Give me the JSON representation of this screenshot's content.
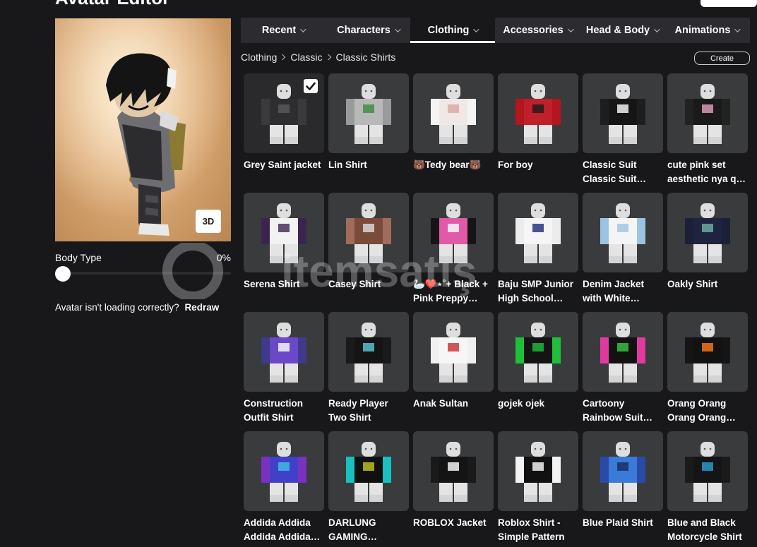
{
  "page": {
    "title": "Avatar Editor"
  },
  "preview": {
    "btn_3d": "3D",
    "body_type_label": "Body Type",
    "body_type_value": "0%",
    "body_type_fraction": 0,
    "loading_text": "Avatar isn't loading correctly?",
    "redraw_label": "Redraw"
  },
  "tabs": [
    {
      "label": "Recent",
      "active": false
    },
    {
      "label": "Characters",
      "active": false
    },
    {
      "label": "Clothing",
      "active": true
    },
    {
      "label": "Accessories",
      "active": false
    },
    {
      "label": "Head & Body",
      "active": false
    },
    {
      "label": "Animations",
      "active": false
    }
  ],
  "breadcrumb": [
    "Clothing",
    "Classic",
    "Classic Shirts"
  ],
  "create_label": "Create",
  "watermark": "itemsatış",
  "items": [
    {
      "name": [
        "Grey Saint jacket"
      ],
      "selected": true,
      "shirt": "#2e2e30",
      "sleeve": "#3a3a3c",
      "accent": "#5a5a5a"
    },
    {
      "name": [
        "Lin Shirt"
      ],
      "selected": false,
      "shirt": "#b8b8b8",
      "sleeve": "#9a9a9a",
      "accent": "#3a8a3a"
    },
    {
      "name": [
        "🐻Tedy bear🐻"
      ],
      "selected": false,
      "shirt": "#efe8e6",
      "sleeve": "#f4f4f4",
      "accent": "#d9a7a0"
    },
    {
      "name": [
        "For boy"
      ],
      "selected": false,
      "shirt": "#c0202a",
      "sleeve": "#b3161c",
      "accent": "#1a1a1a"
    },
    {
      "name": [
        "Classic Suit",
        "Classic Suit…"
      ],
      "selected": false,
      "shirt": "#161616",
      "sleeve": "#1e1e1e",
      "accent": "#ffffff"
    },
    {
      "name": [
        "cute pink set",
        "aesthetic nya q…"
      ],
      "selected": false,
      "shirt": "#1a1a1a",
      "sleeve": "#222222",
      "accent": "#e8a0c0"
    },
    {
      "name": [
        "Serena Shirt"
      ],
      "selected": false,
      "shirt": "#f2f2f2",
      "sleeve": "#3b2550",
      "accent": "#3b2550"
    },
    {
      "name": [
        "Casey Shirt"
      ],
      "selected": false,
      "shirt": "#7a4a3a",
      "sleeve": "#a26c5c",
      "accent": "#e0e0e0"
    },
    {
      "name": [
        "🦢❤️⋆˚+ Black +",
        "Pink Preppy…"
      ],
      "selected": false,
      "shirt": "#e05aa8",
      "sleeve": "#151515",
      "accent": "#ffffff"
    },
    {
      "name": [
        "Baju SMP Junior",
        "High School…"
      ],
      "selected": false,
      "shirt": "#f5f5f5",
      "sleeve": "#ececec",
      "accent": "#1a2a80"
    },
    {
      "name": [
        "Denim Jacket",
        "with White…"
      ],
      "selected": false,
      "shirt": "#f4f4f4",
      "sleeve": "#9cc4e2",
      "accent": "#9cc4e2"
    },
    {
      "name": [
        "Oakly Shirt"
      ],
      "selected": false,
      "shirt": "#1e2440",
      "sleeve": "#1b2036",
      "accent": "#6fb3a4"
    },
    {
      "name": [
        "Construction",
        "Outfit Shirt"
      ],
      "selected": false,
      "shirt": "#6a48c8",
      "sleeve": "#3f3a8a",
      "accent": "#ffffff"
    },
    {
      "name": [
        "Ready Player",
        "Two Shirt"
      ],
      "selected": false,
      "shirt": "#141414",
      "sleeve": "#1a1a1a",
      "accent": "#5ec8d8"
    },
    {
      "name": [
        "Anak Sultan"
      ],
      "selected": false,
      "shirt": "#f6f6f6",
      "sleeve": "#f0f0f0",
      "accent": "#c83030"
    },
    {
      "name": [
        "gojek ojek"
      ],
      "selected": false,
      "shirt": "#141414",
      "sleeve": "#1fbf3a",
      "accent": "#1fbf3a"
    },
    {
      "name": [
        "Cartoony",
        "Rainbow Suit…"
      ],
      "selected": false,
      "shirt": "#121212",
      "sleeve": "#e03aa0",
      "accent": "#3ac84a"
    },
    {
      "name": [
        "Orang Orang",
        "Orang Orang…"
      ],
      "selected": false,
      "shirt": "#121212",
      "sleeve": "#151515",
      "accent": "#ff7a1a"
    },
    {
      "name": [
        "Addida Addida",
        "Addida Addida…"
      ],
      "selected": false,
      "shirt": "#4040c8",
      "sleeve": "#7a30c0",
      "accent": "#40c0e8"
    },
    {
      "name": [
        "DARLUNG",
        "GAMING…"
      ],
      "selected": false,
      "shirt": "#101010",
      "sleeve": "#18c0c0",
      "accent": "#c8c820"
    },
    {
      "name": [
        "ROBLOX Jacket"
      ],
      "selected": false,
      "shirt": "#141414",
      "sleeve": "#1a1a1a",
      "accent": "#ffffff"
    },
    {
      "name": [
        "Roblox Shirt -",
        "Simple Pattern"
      ],
      "selected": false,
      "shirt": "#111111",
      "sleeve": "#f2f2f2",
      "accent": "#ffffff"
    },
    {
      "name": [
        "Blue Plaid Shirt"
      ],
      "selected": false,
      "shirt": "#3a7ad8",
      "sleeve": "#2a4aa8",
      "accent": "#1a2a60"
    },
    {
      "name": [
        "Blue and Black",
        "Motorcycle Shirt"
      ],
      "selected": false,
      "shirt": "#151515",
      "sleeve": "#1a1a1a",
      "accent": "#2aa0d8"
    }
  ]
}
